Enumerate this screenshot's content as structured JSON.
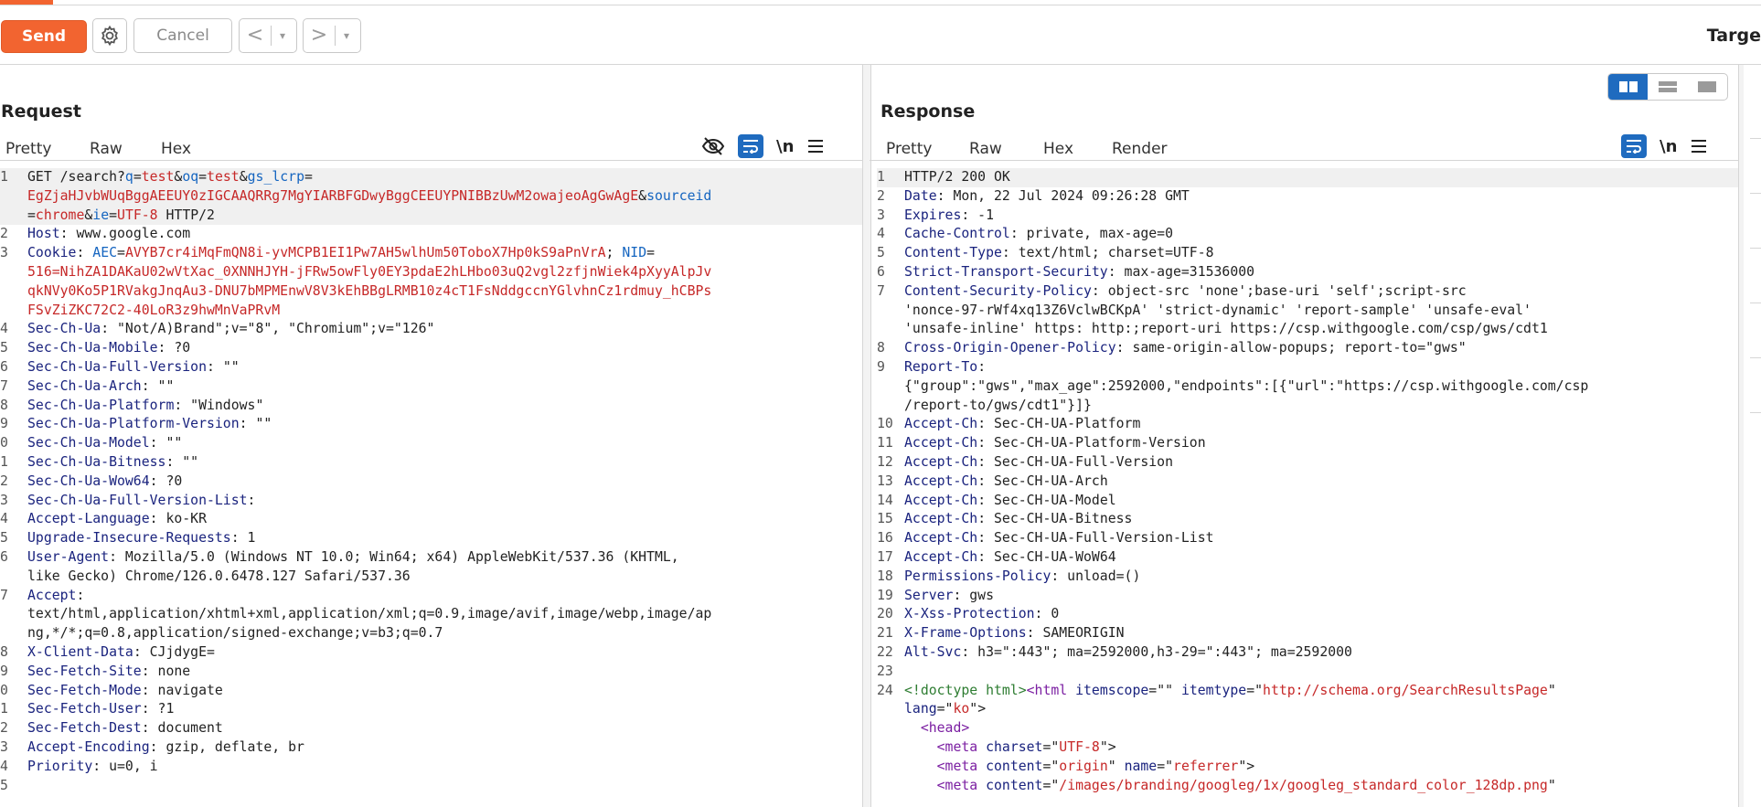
{
  "toolbar": {
    "send": "Send",
    "cancel": "Cancel",
    "back": "<",
    "forward": ">",
    "drop": "▾",
    "target_label": "Targe"
  },
  "request": {
    "title": "Request",
    "tabs": [
      "Pretty",
      "Raw",
      "Hex"
    ],
    "nl": "\\n",
    "lines": [
      {
        "n": "1",
        "parts": [
          {
            "t": "GET /search?"
          },
          {
            "t": "q",
            "c": "p"
          },
          {
            "t": "="
          },
          {
            "t": "test",
            "c": "v"
          },
          {
            "t": "&"
          },
          {
            "t": "oq",
            "c": "p"
          },
          {
            "t": "="
          },
          {
            "t": "test",
            "c": "v"
          },
          {
            "t": "&"
          },
          {
            "t": "gs_lcrp",
            "c": "p"
          },
          {
            "t": "=\n"
          },
          {
            "t": "EgZjaHJvbWUqBggAEEUY0zIGCAAQRRg7MgYIARBFGDwyBggCEEUYPNIBBzUwM2owajeoAgGwAgE",
            "c": "v"
          },
          {
            "t": "&"
          },
          {
            "t": "sourceid",
            "c": "p"
          },
          {
            "t": "\n="
          },
          {
            "t": "chrome",
            "c": "v"
          },
          {
            "t": "&"
          },
          {
            "t": "ie",
            "c": "p"
          },
          {
            "t": "="
          },
          {
            "t": "UTF-8",
            "c": "v"
          },
          {
            "t": " HTTP/2"
          }
        ]
      },
      {
        "n": "2",
        "parts": [
          {
            "t": "Host",
            "c": "k"
          },
          {
            "t": ": www.google.com"
          }
        ]
      },
      {
        "n": "3",
        "parts": [
          {
            "t": "Cookie",
            "c": "k"
          },
          {
            "t": ": "
          },
          {
            "t": "AEC",
            "c": "p"
          },
          {
            "t": "="
          },
          {
            "t": "AVYB7cr4iMqFmQN8i-yvMCPB1EI1Pw7AH5wlhUm50ToboX7Hp0kS9aPnVrA",
            "c": "v"
          },
          {
            "t": "; "
          },
          {
            "t": "NID",
            "c": "p"
          },
          {
            "t": "=\n"
          },
          {
            "t": "516=NihZA1DAKaU02wVtXac_0XNNHJYH-jFRw5owFly0EY3pdaE2hLHbo03uQ2vgl2zfjnWiek4pXyyAlpJv\nqkNVy0Ko5P1RVakgJnqAu3-DNU7bMPMEnwV8V3kEhBBgLRMB10z4cT1FsNddgccnYGlvhnCz1rdmuy_hCBPs\nFSvZiZKC72C2-40LoR3z9hwMnVaPRvM",
            "c": "v"
          }
        ]
      },
      {
        "n": "4",
        "parts": [
          {
            "t": "Sec-Ch-Ua",
            "c": "k"
          },
          {
            "t": ": \"Not/A)Brand\";v=\"8\", \"Chromium\";v=\"126\""
          }
        ]
      },
      {
        "n": "5",
        "parts": [
          {
            "t": "Sec-Ch-Ua-Mobile",
            "c": "k"
          },
          {
            "t": ": ?0"
          }
        ]
      },
      {
        "n": "6",
        "parts": [
          {
            "t": "Sec-Ch-Ua-Full-Version",
            "c": "k"
          },
          {
            "t": ": \"\""
          }
        ]
      },
      {
        "n": "7",
        "parts": [
          {
            "t": "Sec-Ch-Ua-Arch",
            "c": "k"
          },
          {
            "t": ": \"\""
          }
        ]
      },
      {
        "n": "8",
        "parts": [
          {
            "t": "Sec-Ch-Ua-Platform",
            "c": "k"
          },
          {
            "t": ": \"Windows\""
          }
        ]
      },
      {
        "n": "9",
        "parts": [
          {
            "t": "Sec-Ch-Ua-Platform-Version",
            "c": "k"
          },
          {
            "t": ": \"\""
          }
        ]
      },
      {
        "n": "0",
        "parts": [
          {
            "t": "Sec-Ch-Ua-Model",
            "c": "k"
          },
          {
            "t": ": \"\""
          }
        ]
      },
      {
        "n": "1",
        "parts": [
          {
            "t": "Sec-Ch-Ua-Bitness",
            "c": "k"
          },
          {
            "t": ": \"\""
          }
        ]
      },
      {
        "n": "2",
        "parts": [
          {
            "t": "Sec-Ch-Ua-Wow64",
            "c": "k"
          },
          {
            "t": ": ?0"
          }
        ]
      },
      {
        "n": "3",
        "parts": [
          {
            "t": "Sec-Ch-Ua-Full-Version-List",
            "c": "k"
          },
          {
            "t": ":"
          }
        ]
      },
      {
        "n": "4",
        "parts": [
          {
            "t": "Accept-Language",
            "c": "k"
          },
          {
            "t": ": ko-KR"
          }
        ]
      },
      {
        "n": "5",
        "parts": [
          {
            "t": "Upgrade-Insecure-Requests",
            "c": "k"
          },
          {
            "t": ": 1"
          }
        ]
      },
      {
        "n": "6",
        "parts": [
          {
            "t": "User-Agent",
            "c": "k"
          },
          {
            "t": ": Mozilla/5.0 (Windows NT 10.0; Win64; x64) AppleWebKit/537.36 (KHTML,\nlike Gecko) Chrome/126.0.6478.127 Safari/537.36"
          }
        ]
      },
      {
        "n": "7",
        "parts": [
          {
            "t": "Accept",
            "c": "k"
          },
          {
            "t": ":\ntext/html,application/xhtml+xml,application/xml;q=0.9,image/avif,image/webp,image/ap\nng,*/*;q=0.8,application/signed-exchange;v=b3;q=0.7"
          }
        ]
      },
      {
        "n": "8",
        "parts": [
          {
            "t": "X-Client-Data",
            "c": "k"
          },
          {
            "t": ": CJjdygE="
          }
        ]
      },
      {
        "n": "9",
        "parts": [
          {
            "t": "Sec-Fetch-Site",
            "c": "k"
          },
          {
            "t": ": none"
          }
        ]
      },
      {
        "n": "0",
        "parts": [
          {
            "t": "Sec-Fetch-Mode",
            "c": "k"
          },
          {
            "t": ": navigate"
          }
        ]
      },
      {
        "n": "1",
        "parts": [
          {
            "t": "Sec-Fetch-User",
            "c": "k"
          },
          {
            "t": ": ?1"
          }
        ]
      },
      {
        "n": "2",
        "parts": [
          {
            "t": "Sec-Fetch-Dest",
            "c": "k"
          },
          {
            "t": ": document"
          }
        ]
      },
      {
        "n": "3",
        "parts": [
          {
            "t": "Accept-Encoding",
            "c": "k"
          },
          {
            "t": ": gzip, deflate, br"
          }
        ]
      },
      {
        "n": "4",
        "parts": [
          {
            "t": "Priority",
            "c": "k"
          },
          {
            "t": ": u=0, i"
          }
        ]
      },
      {
        "n": "5",
        "parts": [
          {
            "t": ""
          }
        ]
      }
    ]
  },
  "response": {
    "title": "Response",
    "tabs": [
      "Pretty",
      "Raw",
      "Hex",
      "Render"
    ],
    "nl": "\\n",
    "lines": [
      {
        "n": "1",
        "parts": [
          {
            "t": "HTTP/2 200 OK"
          }
        ]
      },
      {
        "n": "2",
        "parts": [
          {
            "t": "Date",
            "c": "k"
          },
          {
            "t": ": Mon, 22 Jul 2024 09:26:28 GMT"
          }
        ]
      },
      {
        "n": "3",
        "parts": [
          {
            "t": "Expires",
            "c": "k"
          },
          {
            "t": ": -1"
          }
        ]
      },
      {
        "n": "4",
        "parts": [
          {
            "t": "Cache-Control",
            "c": "k"
          },
          {
            "t": ": private, max-age=0"
          }
        ]
      },
      {
        "n": "5",
        "parts": [
          {
            "t": "Content-Type",
            "c": "k"
          },
          {
            "t": ": text/html; charset=UTF-8"
          }
        ]
      },
      {
        "n": "6",
        "parts": [
          {
            "t": "Strict-Transport-Security",
            "c": "k"
          },
          {
            "t": ": max-age=31536000"
          }
        ]
      },
      {
        "n": "7",
        "parts": [
          {
            "t": "Content-Security-Policy",
            "c": "k"
          },
          {
            "t": ": object-src 'none';base-uri 'self';script-src\n'nonce-97-rWf4xq13Z6VclwBCKpA' 'strict-dynamic' 'report-sample' 'unsafe-eval'\n'unsafe-inline' https: http:;report-uri https://csp.withgoogle.com/csp/gws/cdt1"
          }
        ]
      },
      {
        "n": "8",
        "parts": [
          {
            "t": "Cross-Origin-Opener-Policy",
            "c": "k"
          },
          {
            "t": ": same-origin-allow-popups; report-to=\"gws\""
          }
        ]
      },
      {
        "n": "9",
        "parts": [
          {
            "t": "Report-To",
            "c": "k"
          },
          {
            "t": ":\n{\"group\":\"gws\",\"max_age\":2592000,\"endpoints\":[{\"url\":\"https://csp.withgoogle.com/csp\n/report-to/gws/cdt1\"}]}"
          }
        ]
      },
      {
        "n": "10",
        "parts": [
          {
            "t": "Accept-Ch",
            "c": "k"
          },
          {
            "t": ": Sec-CH-UA-Platform"
          }
        ]
      },
      {
        "n": "11",
        "parts": [
          {
            "t": "Accept-Ch",
            "c": "k"
          },
          {
            "t": ": Sec-CH-UA-Platform-Version"
          }
        ]
      },
      {
        "n": "12",
        "parts": [
          {
            "t": "Accept-Ch",
            "c": "k"
          },
          {
            "t": ": Sec-CH-UA-Full-Version"
          }
        ]
      },
      {
        "n": "13",
        "parts": [
          {
            "t": "Accept-Ch",
            "c": "k"
          },
          {
            "t": ": Sec-CH-UA-Arch"
          }
        ]
      },
      {
        "n": "14",
        "parts": [
          {
            "t": "Accept-Ch",
            "c": "k"
          },
          {
            "t": ": Sec-CH-UA-Model"
          }
        ]
      },
      {
        "n": "15",
        "parts": [
          {
            "t": "Accept-Ch",
            "c": "k"
          },
          {
            "t": ": Sec-CH-UA-Bitness"
          }
        ]
      },
      {
        "n": "16",
        "parts": [
          {
            "t": "Accept-Ch",
            "c": "k"
          },
          {
            "t": ": Sec-CH-UA-Full-Version-List"
          }
        ]
      },
      {
        "n": "17",
        "parts": [
          {
            "t": "Accept-Ch",
            "c": "k"
          },
          {
            "t": ": Sec-CH-UA-WoW64"
          }
        ]
      },
      {
        "n": "18",
        "parts": [
          {
            "t": "Permissions-Policy",
            "c": "k"
          },
          {
            "t": ": unload=()"
          }
        ]
      },
      {
        "n": "19",
        "parts": [
          {
            "t": "Server",
            "c": "k"
          },
          {
            "t": ": gws"
          }
        ]
      },
      {
        "n": "20",
        "parts": [
          {
            "t": "X-Xss-Protection",
            "c": "k"
          },
          {
            "t": ": 0"
          }
        ]
      },
      {
        "n": "21",
        "parts": [
          {
            "t": "X-Frame-Options",
            "c": "k"
          },
          {
            "t": ": SAMEORIGIN"
          }
        ]
      },
      {
        "n": "22",
        "parts": [
          {
            "t": "Alt-Svc",
            "c": "k"
          },
          {
            "t": ": h3=\":443\"; ma=2592000,h3-29=\":443\"; ma=2592000"
          }
        ]
      },
      {
        "n": "23",
        "parts": [
          {
            "t": ""
          }
        ]
      },
      {
        "n": "24",
        "parts": [
          {
            "t": "<!doctype html>",
            "c": "doctype"
          },
          {
            "t": "<html",
            "c": "tag"
          },
          {
            "t": " "
          },
          {
            "t": "itemscope",
            "c": "k"
          },
          {
            "t": "=\"\" "
          },
          {
            "t": "itemtype",
            "c": "k"
          },
          {
            "t": "=\""
          },
          {
            "t": "http://schema.org/SearchResultsPage",
            "c": "v"
          },
          {
            "t": "\"\n"
          },
          {
            "t": "lang",
            "c": "k"
          },
          {
            "t": "=\""
          },
          {
            "t": "ko",
            "c": "v"
          },
          {
            "t": "\">\n  "
          },
          {
            "t": "<head>",
            "c": "tag"
          },
          {
            "t": "\n    "
          },
          {
            "t": "<meta",
            "c": "tag"
          },
          {
            "t": " "
          },
          {
            "t": "charset",
            "c": "k"
          },
          {
            "t": "=\""
          },
          {
            "t": "UTF-8",
            "c": "v"
          },
          {
            "t": "\">\n    "
          },
          {
            "t": "<meta",
            "c": "tag"
          },
          {
            "t": " "
          },
          {
            "t": "content",
            "c": "k"
          },
          {
            "t": "=\""
          },
          {
            "t": "origin",
            "c": "v"
          },
          {
            "t": "\" "
          },
          {
            "t": "name",
            "c": "k"
          },
          {
            "t": "=\""
          },
          {
            "t": "referrer",
            "c": "v"
          },
          {
            "t": "\">\n    "
          },
          {
            "t": "<meta",
            "c": "tag"
          },
          {
            "t": " "
          },
          {
            "t": "content",
            "c": "k"
          },
          {
            "t": "=\""
          },
          {
            "t": "/images/branding/googleg/1x/googleg_standard_color_128dp.png",
            "c": "v"
          },
          {
            "t": "\""
          }
        ]
      }
    ]
  },
  "colors": {
    "accent": "#f26430",
    "blue": "#1f6bbf"
  }
}
